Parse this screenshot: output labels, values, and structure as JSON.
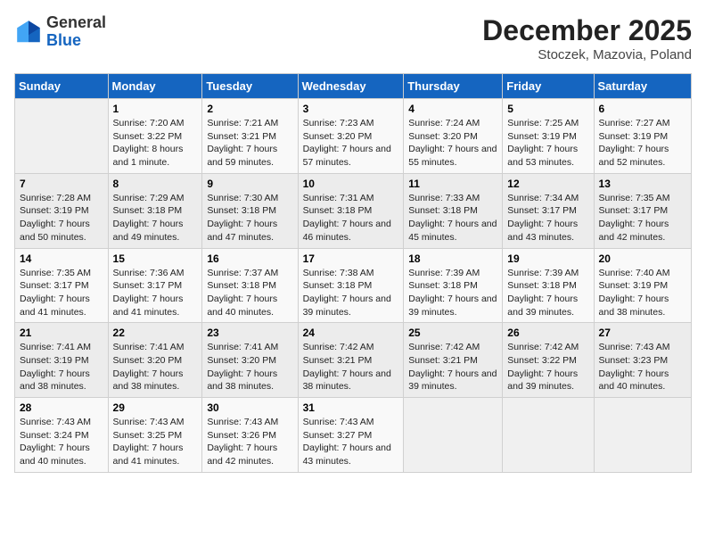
{
  "logo": {
    "general": "General",
    "blue": "Blue"
  },
  "header": {
    "title": "December 2025",
    "subtitle": "Stoczek, Mazovia, Poland"
  },
  "weekdays": [
    "Sunday",
    "Monday",
    "Tuesday",
    "Wednesday",
    "Thursday",
    "Friday",
    "Saturday"
  ],
  "weeks": [
    [
      {
        "day": "",
        "sunrise": "",
        "sunset": "",
        "daylight": ""
      },
      {
        "day": "1",
        "sunrise": "Sunrise: 7:20 AM",
        "sunset": "Sunset: 3:22 PM",
        "daylight": "Daylight: 8 hours and 1 minute."
      },
      {
        "day": "2",
        "sunrise": "Sunrise: 7:21 AM",
        "sunset": "Sunset: 3:21 PM",
        "daylight": "Daylight: 7 hours and 59 minutes."
      },
      {
        "day": "3",
        "sunrise": "Sunrise: 7:23 AM",
        "sunset": "Sunset: 3:20 PM",
        "daylight": "Daylight: 7 hours and 57 minutes."
      },
      {
        "day": "4",
        "sunrise": "Sunrise: 7:24 AM",
        "sunset": "Sunset: 3:20 PM",
        "daylight": "Daylight: 7 hours and 55 minutes."
      },
      {
        "day": "5",
        "sunrise": "Sunrise: 7:25 AM",
        "sunset": "Sunset: 3:19 PM",
        "daylight": "Daylight: 7 hours and 53 minutes."
      },
      {
        "day": "6",
        "sunrise": "Sunrise: 7:27 AM",
        "sunset": "Sunset: 3:19 PM",
        "daylight": "Daylight: 7 hours and 52 minutes."
      }
    ],
    [
      {
        "day": "7",
        "sunrise": "Sunrise: 7:28 AM",
        "sunset": "Sunset: 3:19 PM",
        "daylight": "Daylight: 7 hours and 50 minutes."
      },
      {
        "day": "8",
        "sunrise": "Sunrise: 7:29 AM",
        "sunset": "Sunset: 3:18 PM",
        "daylight": "Daylight: 7 hours and 49 minutes."
      },
      {
        "day": "9",
        "sunrise": "Sunrise: 7:30 AM",
        "sunset": "Sunset: 3:18 PM",
        "daylight": "Daylight: 7 hours and 47 minutes."
      },
      {
        "day": "10",
        "sunrise": "Sunrise: 7:31 AM",
        "sunset": "Sunset: 3:18 PM",
        "daylight": "Daylight: 7 hours and 46 minutes."
      },
      {
        "day": "11",
        "sunrise": "Sunrise: 7:33 AM",
        "sunset": "Sunset: 3:18 PM",
        "daylight": "Daylight: 7 hours and 45 minutes."
      },
      {
        "day": "12",
        "sunrise": "Sunrise: 7:34 AM",
        "sunset": "Sunset: 3:17 PM",
        "daylight": "Daylight: 7 hours and 43 minutes."
      },
      {
        "day": "13",
        "sunrise": "Sunrise: 7:35 AM",
        "sunset": "Sunset: 3:17 PM",
        "daylight": "Daylight: 7 hours and 42 minutes."
      }
    ],
    [
      {
        "day": "14",
        "sunrise": "Sunrise: 7:35 AM",
        "sunset": "Sunset: 3:17 PM",
        "daylight": "Daylight: 7 hours and 41 minutes."
      },
      {
        "day": "15",
        "sunrise": "Sunrise: 7:36 AM",
        "sunset": "Sunset: 3:17 PM",
        "daylight": "Daylight: 7 hours and 41 minutes."
      },
      {
        "day": "16",
        "sunrise": "Sunrise: 7:37 AM",
        "sunset": "Sunset: 3:18 PM",
        "daylight": "Daylight: 7 hours and 40 minutes."
      },
      {
        "day": "17",
        "sunrise": "Sunrise: 7:38 AM",
        "sunset": "Sunset: 3:18 PM",
        "daylight": "Daylight: 7 hours and 39 minutes."
      },
      {
        "day": "18",
        "sunrise": "Sunrise: 7:39 AM",
        "sunset": "Sunset: 3:18 PM",
        "daylight": "Daylight: 7 hours and 39 minutes."
      },
      {
        "day": "19",
        "sunrise": "Sunrise: 7:39 AM",
        "sunset": "Sunset: 3:18 PM",
        "daylight": "Daylight: 7 hours and 39 minutes."
      },
      {
        "day": "20",
        "sunrise": "Sunrise: 7:40 AM",
        "sunset": "Sunset: 3:19 PM",
        "daylight": "Daylight: 7 hours and 38 minutes."
      }
    ],
    [
      {
        "day": "21",
        "sunrise": "Sunrise: 7:41 AM",
        "sunset": "Sunset: 3:19 PM",
        "daylight": "Daylight: 7 hours and 38 minutes."
      },
      {
        "day": "22",
        "sunrise": "Sunrise: 7:41 AM",
        "sunset": "Sunset: 3:20 PM",
        "daylight": "Daylight: 7 hours and 38 minutes."
      },
      {
        "day": "23",
        "sunrise": "Sunrise: 7:41 AM",
        "sunset": "Sunset: 3:20 PM",
        "daylight": "Daylight: 7 hours and 38 minutes."
      },
      {
        "day": "24",
        "sunrise": "Sunrise: 7:42 AM",
        "sunset": "Sunset: 3:21 PM",
        "daylight": "Daylight: 7 hours and 38 minutes."
      },
      {
        "day": "25",
        "sunrise": "Sunrise: 7:42 AM",
        "sunset": "Sunset: 3:21 PM",
        "daylight": "Daylight: 7 hours and 39 minutes."
      },
      {
        "day": "26",
        "sunrise": "Sunrise: 7:42 AM",
        "sunset": "Sunset: 3:22 PM",
        "daylight": "Daylight: 7 hours and 39 minutes."
      },
      {
        "day": "27",
        "sunrise": "Sunrise: 7:43 AM",
        "sunset": "Sunset: 3:23 PM",
        "daylight": "Daylight: 7 hours and 40 minutes."
      }
    ],
    [
      {
        "day": "28",
        "sunrise": "Sunrise: 7:43 AM",
        "sunset": "Sunset: 3:24 PM",
        "daylight": "Daylight: 7 hours and 40 minutes."
      },
      {
        "day": "29",
        "sunrise": "Sunrise: 7:43 AM",
        "sunset": "Sunset: 3:25 PM",
        "daylight": "Daylight: 7 hours and 41 minutes."
      },
      {
        "day": "30",
        "sunrise": "Sunrise: 7:43 AM",
        "sunset": "Sunset: 3:26 PM",
        "daylight": "Daylight: 7 hours and 42 minutes."
      },
      {
        "day": "31",
        "sunrise": "Sunrise: 7:43 AM",
        "sunset": "Sunset: 3:27 PM",
        "daylight": "Daylight: 7 hours and 43 minutes."
      },
      {
        "day": "",
        "sunrise": "",
        "sunset": "",
        "daylight": ""
      },
      {
        "day": "",
        "sunrise": "",
        "sunset": "",
        "daylight": ""
      },
      {
        "day": "",
        "sunrise": "",
        "sunset": "",
        "daylight": ""
      }
    ]
  ]
}
